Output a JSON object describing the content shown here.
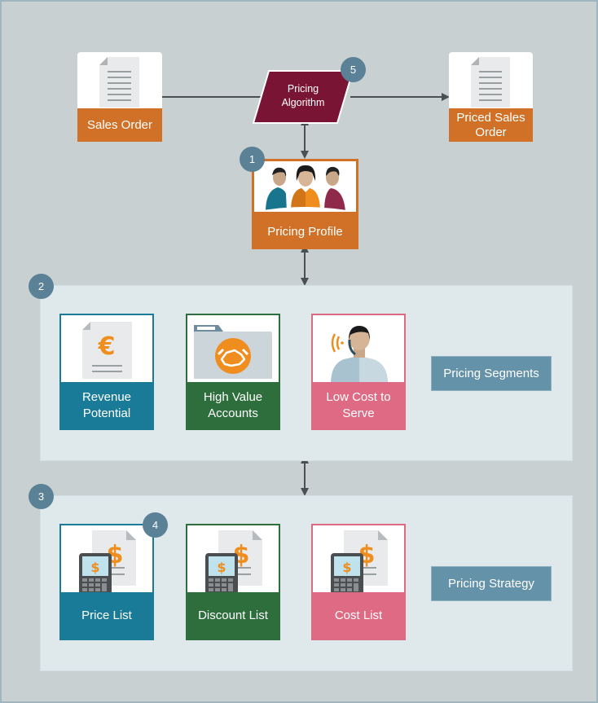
{
  "top_flow": {
    "sales_order": {
      "label": "Sales Order",
      "icon": "document-icon"
    },
    "pricing_algorithm": {
      "line1": "Pricing",
      "line2": "Algorithm",
      "badge": "5"
    },
    "priced_sales_order": {
      "line1": "Priced Sales",
      "line2": "Order",
      "icon": "document-icon"
    }
  },
  "pricing_profile": {
    "label": "Pricing Profile",
    "badge": "1",
    "icon": "people-icon"
  },
  "segments_panel": {
    "badge": "2",
    "tag": "Pricing Segments",
    "cards": [
      {
        "line1": "Revenue",
        "line2": "Potential",
        "icon": "euro-document-icon",
        "color": "#1a7b98"
      },
      {
        "line1": "High Value",
        "line2": "Accounts",
        "icon": "handshake-folder-icon",
        "color": "#2d6e3c"
      },
      {
        "line1": "Low Cost to",
        "line2": "Serve",
        "icon": "call-agent-icon",
        "color": "#df6a84"
      }
    ]
  },
  "strategy_panel": {
    "badge": "3",
    "tag": "Pricing Strategy",
    "cards": [
      {
        "label": "Price List",
        "icon": "calculator-dollar-icon",
        "badge": "4",
        "color": "#1a7b98"
      },
      {
        "label": "Discount List",
        "icon": "calculator-dollar-icon",
        "color": "#2d6e3c"
      },
      {
        "label": "Cost List",
        "icon": "calculator-dollar-icon",
        "color": "#df6a84"
      }
    ]
  },
  "colors": {
    "background": "#c8d0d2",
    "panel": "#dfe9eb",
    "orange": "#d07127",
    "algorithm": "#7a1434",
    "badge": "#5b8197",
    "tag": "#6492a8"
  }
}
